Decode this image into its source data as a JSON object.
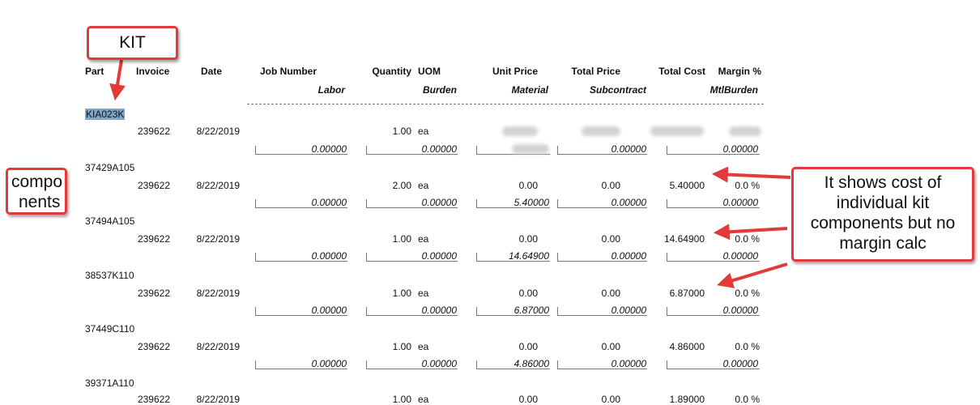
{
  "headers": {
    "part": "Part",
    "invoice": "Invoice",
    "date": "Date",
    "job_number": "Job Number",
    "quantity": "Quantity",
    "uom": "UOM",
    "unit_price": "Unit Price",
    "total_price": "Total Price",
    "total_cost": "Total Cost",
    "margin": "Margin %"
  },
  "subheaders": {
    "labor": "Labor",
    "burden": "Burden",
    "material": "Material",
    "subcontract": "Subcontract",
    "mtlburden": "MtlBurden"
  },
  "kit": {
    "part": "KIA023K",
    "invoice": "239622",
    "date": "8/22/2019",
    "quantity": "1.00",
    "uom": "ea",
    "labor": "0.00000",
    "burden": "0.00000",
    "subcontract": "0.00000",
    "mtlburden": "0.00000"
  },
  "rows": [
    {
      "part": "37429A105",
      "invoice": "239622",
      "date": "8/22/2019",
      "quantity": "2.00",
      "uom": "ea",
      "unit_price": "0.00",
      "total_price": "0.00",
      "total_cost": "5.40000",
      "margin": "0.0 %",
      "labor": "0.00000",
      "burden": "0.00000",
      "material": "5.40000",
      "subcontract": "0.00000",
      "mtlburden": "0.00000"
    },
    {
      "part": "37494A105",
      "invoice": "239622",
      "date": "8/22/2019",
      "quantity": "1.00",
      "uom": "ea",
      "unit_price": "0.00",
      "total_price": "0.00",
      "total_cost": "14.64900",
      "margin": "0.0 %",
      "labor": "0.00000",
      "burden": "0.00000",
      "material": "14.64900",
      "subcontract": "0.00000",
      "mtlburden": "0.00000"
    },
    {
      "part": "38537K110",
      "invoice": "239622",
      "date": "8/22/2019",
      "quantity": "1.00",
      "uom": "ea",
      "unit_price": "0.00",
      "total_price": "0.00",
      "total_cost": "6.87000",
      "margin": "0.0 %",
      "labor": "0.00000",
      "burden": "0.00000",
      "material": "6.87000",
      "subcontract": "0.00000",
      "mtlburden": "0.00000"
    },
    {
      "part": "37449C110",
      "invoice": "239622",
      "date": "8/22/2019",
      "quantity": "1.00",
      "uom": "ea",
      "unit_price": "0.00",
      "total_price": "0.00",
      "total_cost": "4.86000",
      "margin": "0.0 %",
      "labor": "0.00000",
      "burden": "0.00000",
      "material": "4.86000",
      "subcontract": "0.00000",
      "mtlburden": "0.00000"
    }
  ],
  "partial_row": {
    "part": "39371A110",
    "invoice": "239622",
    "date": "8/22/2019",
    "quantity": "1.00",
    "uom": "ea",
    "unit_price": "0.00",
    "total_price": "0.00",
    "total_cost": "1.89000",
    "margin": "0.0 %"
  },
  "annotations": {
    "kit": "KIT",
    "components_1": "compo",
    "components_2": "nents",
    "note_1": "It shows cost of",
    "note_2": "individual kit",
    "note_3": "components but no",
    "note_4": "margin calc"
  },
  "colors": {
    "callout_border": "#e23a3a",
    "selection": "#7ea6c8"
  }
}
